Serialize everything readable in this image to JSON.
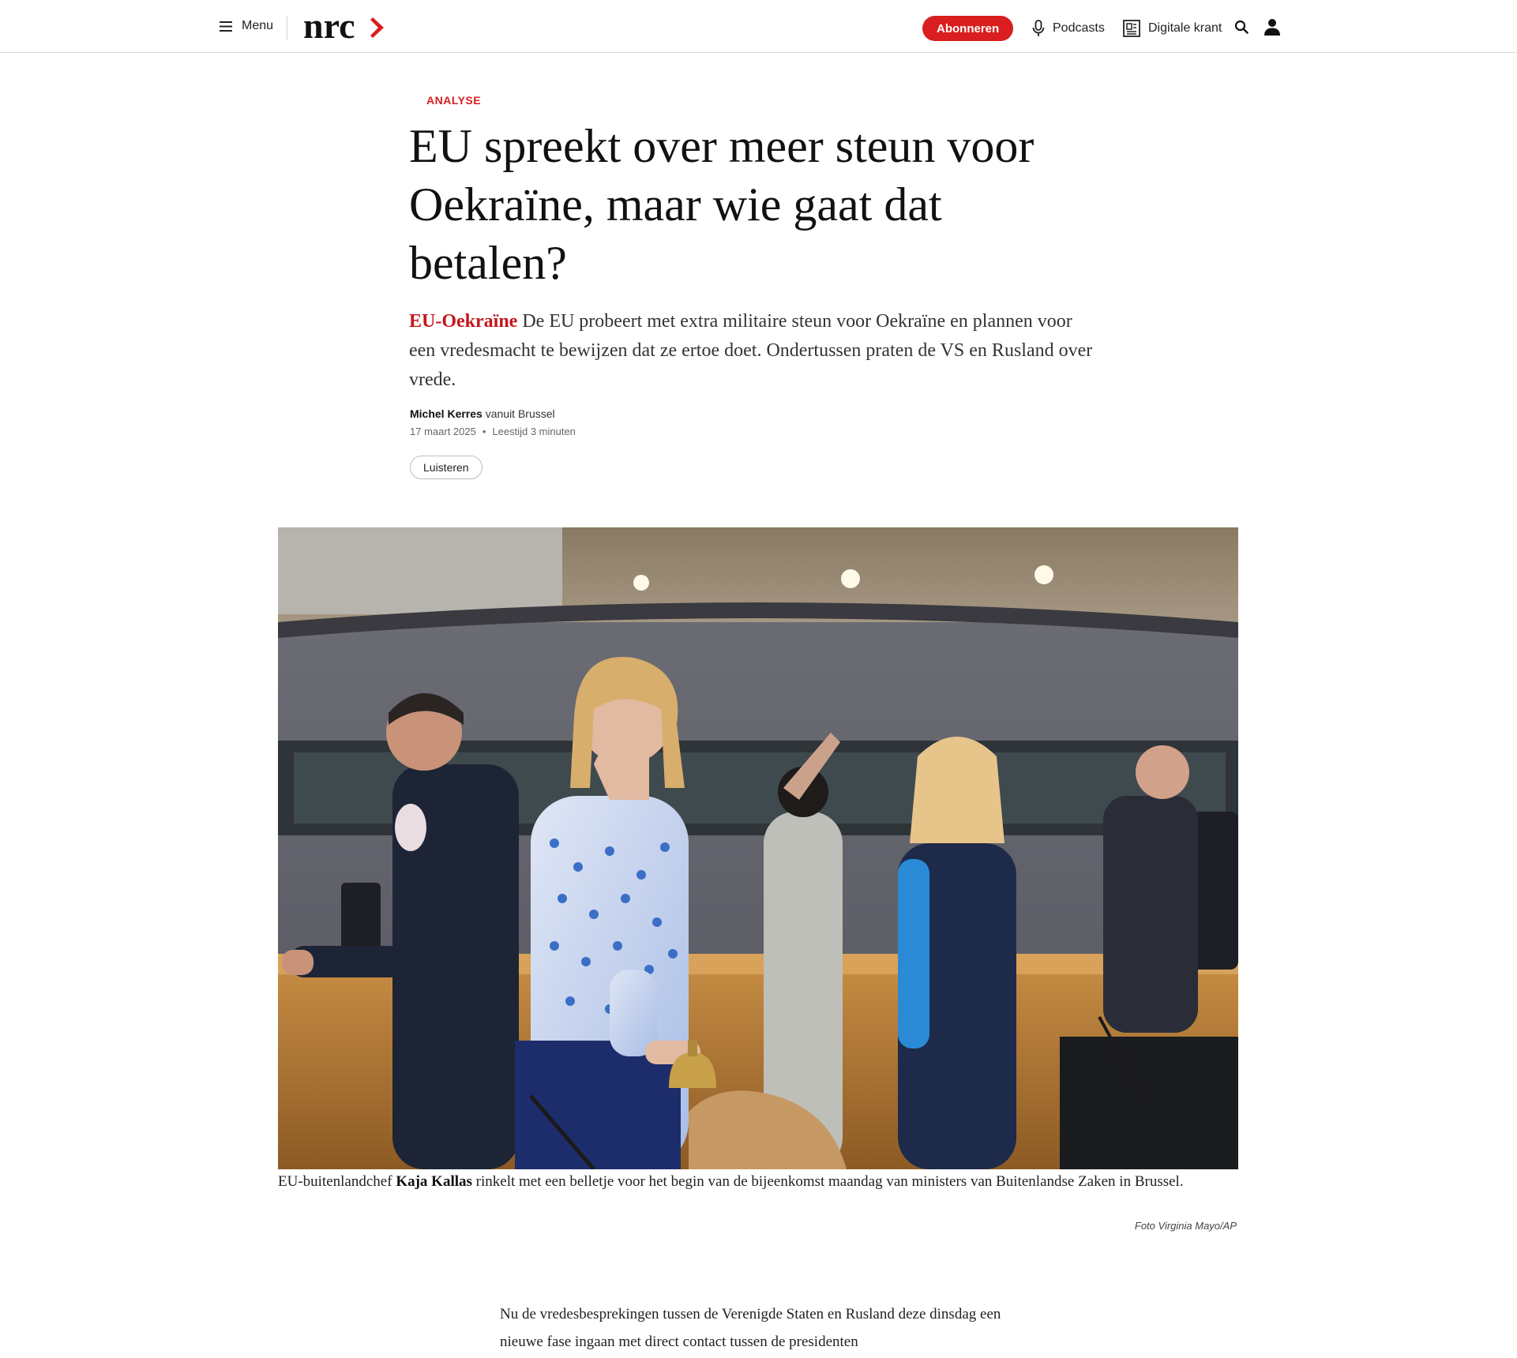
{
  "header": {
    "menu_label": "Menu",
    "logo_text": "nrc",
    "subscribe_label": "Abonneren",
    "podcasts_label": "Podcasts",
    "digital_label": "Digitale krant",
    "brand_color": "#d81e1e"
  },
  "icons": {
    "menu": "menu-icon",
    "podcasts": "microphone-icon",
    "digital": "newspaper-icon",
    "search": "search-icon",
    "account": "user-icon"
  },
  "article": {
    "kicker": "ANALYSE",
    "headline": "EU spreekt over meer steun voor Oekraïne, maar wie gaat dat betalen?",
    "intro_tag": "EU-Oekraïne",
    "intro_text": " De EU probeert met extra militaire steun voor Oekraïne en plannen voor een vredesmacht te bewijzen dat ze ertoe doet. Ondertussen praten de VS en Rusland over vrede.",
    "author": "Michel Kerres",
    "location": " vanuit Brussel",
    "date": "17 maart 2025",
    "separator": "•",
    "reading_time": "Leestijd 3 minuten",
    "listen_label": "Luisteren"
  },
  "photo": {
    "caption_prefix": "EU-buitenlandchef ",
    "caption_name": "Kaja Kallas",
    "caption_suffix": " rinkelt met een belletje voor het begin van de bijeenkomst maandag van ministers van Buitenlandse Zaken in Brussel.",
    "credit": "Foto Virginia Mayo/AP"
  },
  "body": {
    "paragraph_start": "Nu de vredesbesprekingen tussen de Verenigde Staten en Rusland deze dinsdag een nieuwe fase ingaan met direct contact tussen de presidenten"
  }
}
